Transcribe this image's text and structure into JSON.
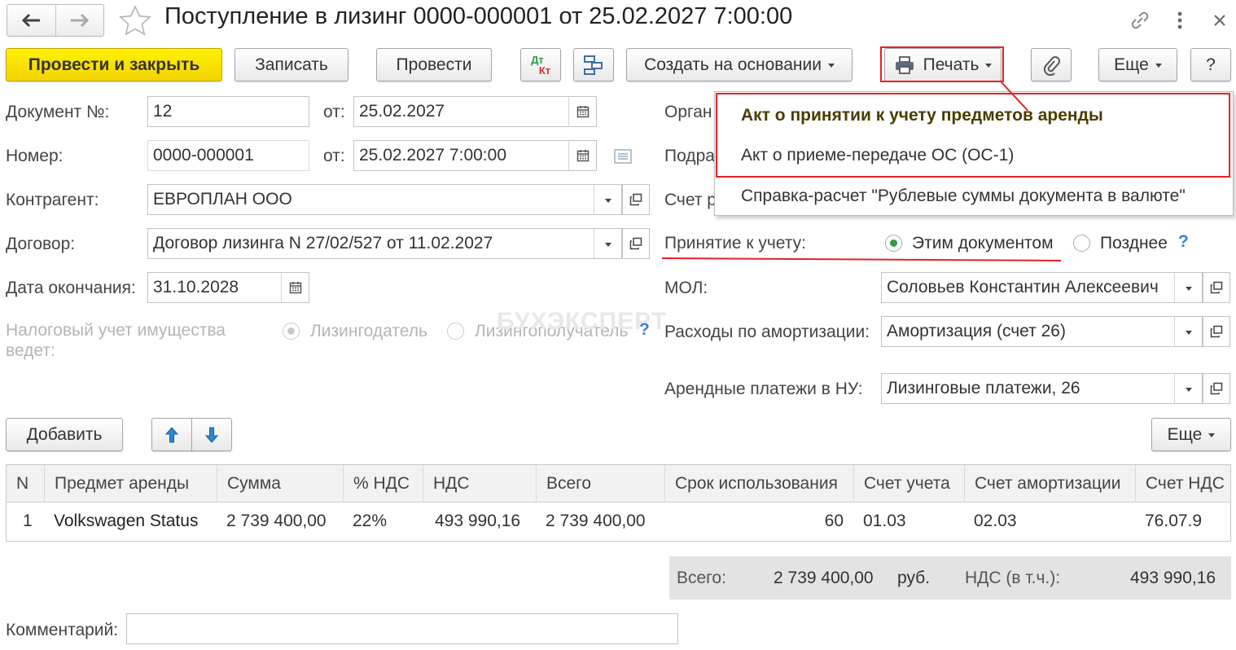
{
  "window": {
    "title": "Поступление в лизинг 0000-000001 от 25.02.2027 7:00:00"
  },
  "toolbar": {
    "post_and_close": "Провести и закрыть",
    "save": "Записать",
    "post": "Провести",
    "dtkt_top": "Дт",
    "dtkt_bottom": "Кт",
    "create_based": "Создать на основании",
    "print": "Печать",
    "more": "Еще",
    "help": "?"
  },
  "form": {
    "doc_number_label": "Документ №:",
    "doc_number_value": "12",
    "from_label": "от:",
    "doc_date_value": "25.02.2027",
    "number_label": "Номер:",
    "number_value": "0000-000001",
    "number_date_value": "25.02.2027  7:00:00",
    "counterparty_label": "Контрагент:",
    "counterparty_value": "ЕВРОПЛАН ООО",
    "contract_label": "Договор:",
    "contract_value": "Договор лизинга N 27/02/527 от 11.02.2027",
    "end_date_label": "Дата окончания:",
    "end_date_value": "31.10.2028",
    "tax_label_line1": "Налоговый учет имущества",
    "tax_label_line2": "ведет:",
    "tax_opt_lessor": "Лизингодатель",
    "tax_opt_lessee": "Лизингополучатель",
    "org_label_partial": "Орган",
    "dept_label_partial": "Подра",
    "account_label_partial": "Счет р",
    "acceptance_label": "Принятие к учету:",
    "acceptance_opt_this": "Этим документом",
    "acceptance_opt_later": "Позднее",
    "mol_label": "МОЛ:",
    "mol_value": "Соловьев Константин Алексеевич",
    "amort_label": "Расходы по амортизации:",
    "amort_value": "Амортизация (счет 26)",
    "lease_payments_label": "Арендные платежи в НУ:",
    "lease_payments_value": "Лизинговые платежи, 26",
    "help_mark": "?"
  },
  "table_toolbar": {
    "add": "Добавить",
    "more": "Еще"
  },
  "table": {
    "columns": [
      "N",
      "Предмет аренды",
      "Сумма",
      "% НДС",
      "НДС",
      "Всего",
      "Срок использования",
      "Счет учета",
      "Счет амортизации",
      "Счет НДС"
    ],
    "rows": [
      [
        "1",
        "Volkswagen Status",
        "2 739 400,00",
        "22%",
        "493 990,16",
        "2 739 400,00",
        "60",
        "01.03",
        "02.03",
        "76.07.9"
      ]
    ]
  },
  "totals": {
    "total_label": "Всего:",
    "total_value": "2 739 400,00",
    "currency": "руб.",
    "vat_label": "НДС (в т.ч.):",
    "vat_value": "493 990,16"
  },
  "comment": {
    "label": "Комментарий:",
    "value": ""
  },
  "print_menu": {
    "items": [
      "Акт о принятии к учету предметов аренды",
      "Акт о приеме-передаче ОС (ОС-1)",
      "Справка-расчет \"Рублевые суммы документа в валюте\""
    ]
  },
  "watermark": "БУХЭКСПЕРТ",
  "colors": {
    "primary_button": "#f7e000",
    "highlight_red": "#e32227",
    "radio_selected": "#2e9a45",
    "help_blue": "#3b7fd1"
  }
}
